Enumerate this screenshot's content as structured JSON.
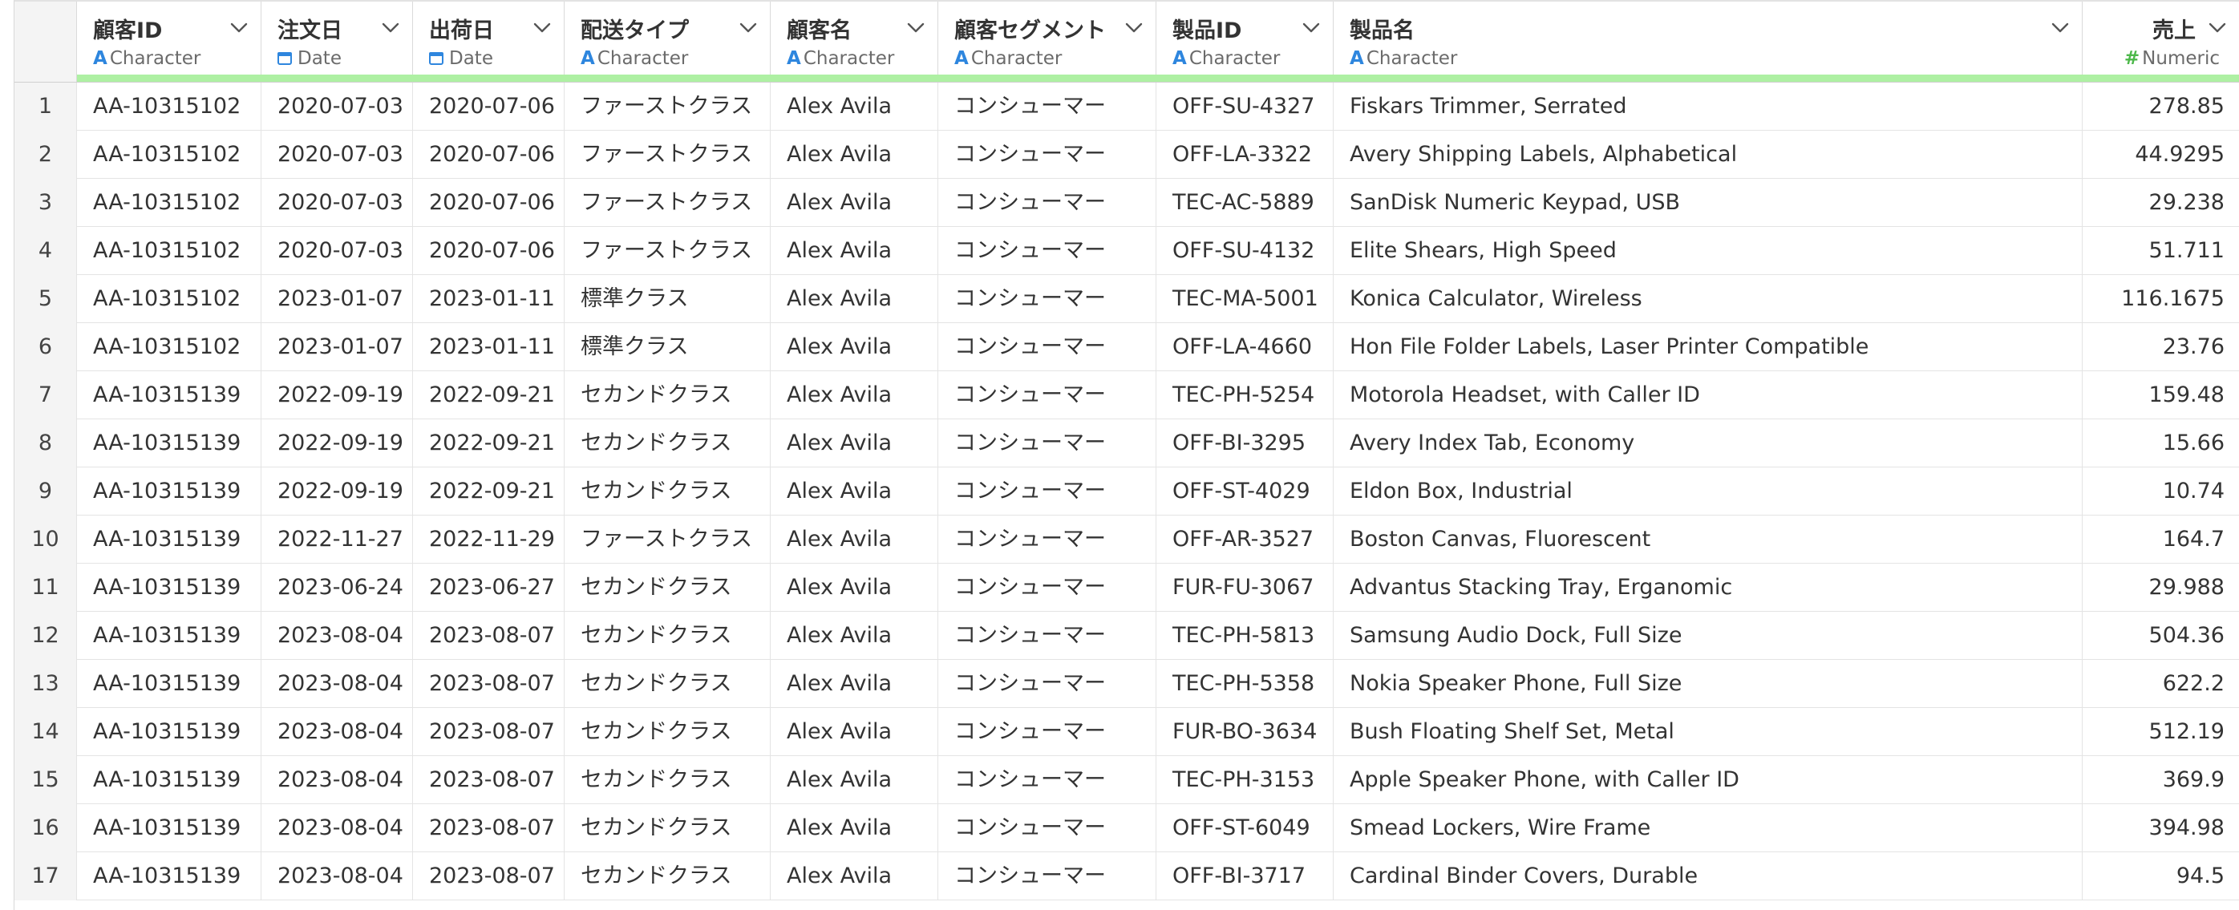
{
  "columns": [
    {
      "name": "顧客ID",
      "type": "Character"
    },
    {
      "name": "注文日",
      "type": "Date"
    },
    {
      "name": "出荷日",
      "type": "Date"
    },
    {
      "name": "配送タイプ",
      "type": "Character"
    },
    {
      "name": "顧客名",
      "type": "Character"
    },
    {
      "name": "顧客セグメント",
      "type": "Character"
    },
    {
      "name": "製品ID",
      "type": "Character"
    },
    {
      "name": "製品名",
      "type": "Character"
    },
    {
      "name": "売上",
      "type": "Numeric"
    }
  ],
  "colors": {
    "character_icon": "#2e86de",
    "numeric_icon": "#4db84a",
    "type_bar": "#aef0a3"
  },
  "rows": [
    {
      "n": "1",
      "cells": [
        "AA-10315102",
        "2020-07-03",
        "2020-07-06",
        "ファーストクラス",
        "Alex Avila",
        "コンシューマー",
        "OFF-SU-4327",
        "Fiskars Trimmer, Serrated",
        "278.85"
      ]
    },
    {
      "n": "2",
      "cells": [
        "AA-10315102",
        "2020-07-03",
        "2020-07-06",
        "ファーストクラス",
        "Alex Avila",
        "コンシューマー",
        "OFF-LA-3322",
        "Avery Shipping Labels, Alphabetical",
        "44.9295"
      ]
    },
    {
      "n": "3",
      "cells": [
        "AA-10315102",
        "2020-07-03",
        "2020-07-06",
        "ファーストクラス",
        "Alex Avila",
        "コンシューマー",
        "TEC-AC-5889",
        "SanDisk Numeric Keypad, USB",
        "29.238"
      ]
    },
    {
      "n": "4",
      "cells": [
        "AA-10315102",
        "2020-07-03",
        "2020-07-06",
        "ファーストクラス",
        "Alex Avila",
        "コンシューマー",
        "OFF-SU-4132",
        "Elite Shears, High Speed",
        "51.711"
      ]
    },
    {
      "n": "5",
      "cells": [
        "AA-10315102",
        "2023-01-07",
        "2023-01-11",
        "標準クラス",
        "Alex Avila",
        "コンシューマー",
        "TEC-MA-5001",
        "Konica Calculator, Wireless",
        "116.1675"
      ]
    },
    {
      "n": "6",
      "cells": [
        "AA-10315102",
        "2023-01-07",
        "2023-01-11",
        "標準クラス",
        "Alex Avila",
        "コンシューマー",
        "OFF-LA-4660",
        "Hon File Folder Labels, Laser Printer Compatible",
        "23.76"
      ]
    },
    {
      "n": "7",
      "cells": [
        "AA-10315139",
        "2022-09-19",
        "2022-09-21",
        "セカンドクラス",
        "Alex Avila",
        "コンシューマー",
        "TEC-PH-5254",
        "Motorola Headset, with Caller ID",
        "159.48"
      ]
    },
    {
      "n": "8",
      "cells": [
        "AA-10315139",
        "2022-09-19",
        "2022-09-21",
        "セカンドクラス",
        "Alex Avila",
        "コンシューマー",
        "OFF-BI-3295",
        "Avery Index Tab, Economy",
        "15.66"
      ]
    },
    {
      "n": "9",
      "cells": [
        "AA-10315139",
        "2022-09-19",
        "2022-09-21",
        "セカンドクラス",
        "Alex Avila",
        "コンシューマー",
        "OFF-ST-4029",
        "Eldon Box, Industrial",
        "10.74"
      ]
    },
    {
      "n": "10",
      "cells": [
        "AA-10315139",
        "2022-11-27",
        "2022-11-29",
        "ファーストクラス",
        "Alex Avila",
        "コンシューマー",
        "OFF-AR-3527",
        "Boston Canvas, Fluorescent",
        "164.7"
      ]
    },
    {
      "n": "11",
      "cells": [
        "AA-10315139",
        "2023-06-24",
        "2023-06-27",
        "セカンドクラス",
        "Alex Avila",
        "コンシューマー",
        "FUR-FU-3067",
        "Advantus Stacking Tray, Erganomic",
        "29.988"
      ]
    },
    {
      "n": "12",
      "cells": [
        "AA-10315139",
        "2023-08-04",
        "2023-08-07",
        "セカンドクラス",
        "Alex Avila",
        "コンシューマー",
        "TEC-PH-5813",
        "Samsung Audio Dock, Full Size",
        "504.36"
      ]
    },
    {
      "n": "13",
      "cells": [
        "AA-10315139",
        "2023-08-04",
        "2023-08-07",
        "セカンドクラス",
        "Alex Avila",
        "コンシューマー",
        "TEC-PH-5358",
        "Nokia Speaker Phone, Full Size",
        "622.2"
      ]
    },
    {
      "n": "14",
      "cells": [
        "AA-10315139",
        "2023-08-04",
        "2023-08-07",
        "セカンドクラス",
        "Alex Avila",
        "コンシューマー",
        "FUR-BO-3634",
        "Bush Floating Shelf Set, Metal",
        "512.19"
      ]
    },
    {
      "n": "15",
      "cells": [
        "AA-10315139",
        "2023-08-04",
        "2023-08-07",
        "セカンドクラス",
        "Alex Avila",
        "コンシューマー",
        "TEC-PH-3153",
        "Apple Speaker Phone, with Caller ID",
        "369.9"
      ]
    },
    {
      "n": "16",
      "cells": [
        "AA-10315139",
        "2023-08-04",
        "2023-08-07",
        "セカンドクラス",
        "Alex Avila",
        "コンシューマー",
        "OFF-ST-6049",
        "Smead Lockers, Wire Frame",
        "394.98"
      ]
    },
    {
      "n": "17",
      "cells": [
        "AA-10315139",
        "2023-08-04",
        "2023-08-07",
        "セカンドクラス",
        "Alex Avila",
        "コンシューマー",
        "OFF-BI-3717",
        "Cardinal Binder Covers, Durable",
        "94.5"
      ]
    }
  ]
}
